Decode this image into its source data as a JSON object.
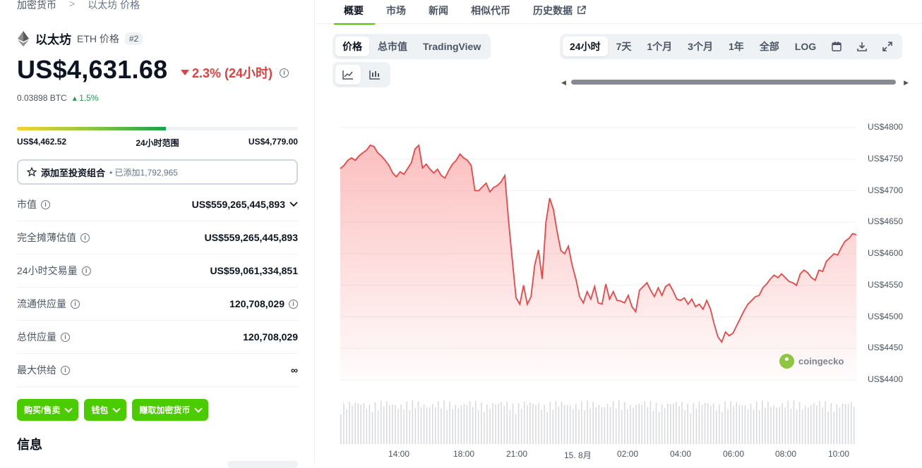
{
  "breadcrumb": {
    "root": "加密货币",
    "sep": ">",
    "current": "以太坊 价格"
  },
  "coin": {
    "name": "以太坊",
    "symbol": "ETH 价格",
    "rank": "#2"
  },
  "price": {
    "value": "US$4,631.68",
    "change": "2.3% (24小时)",
    "change_dir": "down",
    "btc": "0.03898 BTC",
    "btc_change": "1.5%"
  },
  "range": {
    "low": "US$4,462.52",
    "label": "24小时范围",
    "high": "US$4,779.00",
    "fill_fraction": 0.53
  },
  "portfolio": {
    "label": "添加至投资组合",
    "sub": "• 已添加1,792,965"
  },
  "stats": [
    {
      "label": "市值",
      "value": "US$559,265,445,893"
    },
    {
      "label": "完全摊薄估值",
      "value": "US$559,265,445,893"
    },
    {
      "label": "24小时交易量",
      "value": "US$59,061,334,851"
    },
    {
      "label": "流通供应量",
      "value": "120,708,029"
    },
    {
      "label": "总供应量",
      "value": "120,708,029"
    },
    {
      "label": "最大供给",
      "value": "∞"
    }
  ],
  "actions": {
    "buy": "购买/售卖",
    "wallet": "钱包",
    "earn": "赚取加密货币"
  },
  "info_heading": "信息",
  "tabs": [
    "概要",
    "市场",
    "新闻",
    "相似代币",
    "历史数据"
  ],
  "chart_mode": {
    "price": "价格",
    "mcap": "总市值",
    "tv": "TradingView"
  },
  "ranges": [
    "24小时",
    "7天",
    "1个月",
    "3个月",
    "1年",
    "全部",
    "LOG"
  ],
  "watermark": "coingecko",
  "colors": {
    "accent": "#4bcc00",
    "down": "#e53e3e",
    "up": "#16a34a",
    "line": "#ef4444"
  },
  "chart_data": {
    "type": "area",
    "title": "",
    "ylabel": "",
    "xlabel": "",
    "ylim": [
      4400,
      4800
    ],
    "yticks": [
      "US$4800",
      "US$4750",
      "US$4700",
      "US$4650",
      "US$4600",
      "US$4550",
      "US$4500",
      "US$4450",
      "US$4400"
    ],
    "xticks": [
      "14:00",
      "18:00",
      "21:00",
      "15. 8月",
      "02:00",
      "04:00",
      "06:00",
      "08:00",
      "10:00"
    ],
    "series": [
      {
        "values": [
          4735,
          4740,
          4748,
          4752,
          4748,
          4755,
          4760,
          4764,
          4772,
          4770,
          4760,
          4755,
          4748,
          4740,
          4728,
          4722,
          4730,
          4726,
          4735,
          4744,
          4766,
          4772,
          4736,
          4742,
          4734,
          4728,
          4734,
          4724,
          4720,
          4732,
          4742,
          4748,
          4758,
          4752,
          4748,
          4740,
          4700,
          4700,
          4706,
          4712,
          4698,
          4705,
          4708,
          4714,
          4724,
          4652,
          4590,
          4530,
          4520,
          4550,
          4520,
          4532,
          4582,
          4606,
          4560,
          4650,
          4688,
          4670,
          4635,
          4605,
          4600,
          4612,
          4582,
          4560,
          4532,
          4522,
          4540,
          4528,
          4548,
          4522,
          4520,
          4552,
          4528,
          4540,
          4526,
          4525,
          4522,
          4534,
          4516,
          4508,
          4542,
          4548,
          4554,
          4542,
          4532,
          4546,
          4534,
          4548,
          4552,
          4541,
          4528,
          4526,
          4530,
          4520,
          4528,
          4516,
          4520,
          4512,
          4526,
          4512,
          4488,
          4468,
          4460,
          4476,
          4470,
          4474,
          4486,
          4498,
          4510,
          4520,
          4526,
          4532,
          4534,
          4546,
          4552,
          4560,
          4566,
          4562,
          4568,
          4562,
          4556,
          4554,
          4550,
          4568,
          4574,
          4570,
          4562,
          4558,
          4574,
          4572,
          4588,
          4594,
          4600,
          4598,
          4610,
          4620,
          4624,
          4632,
          4630
        ]
      }
    ],
    "volume_shown": true
  }
}
